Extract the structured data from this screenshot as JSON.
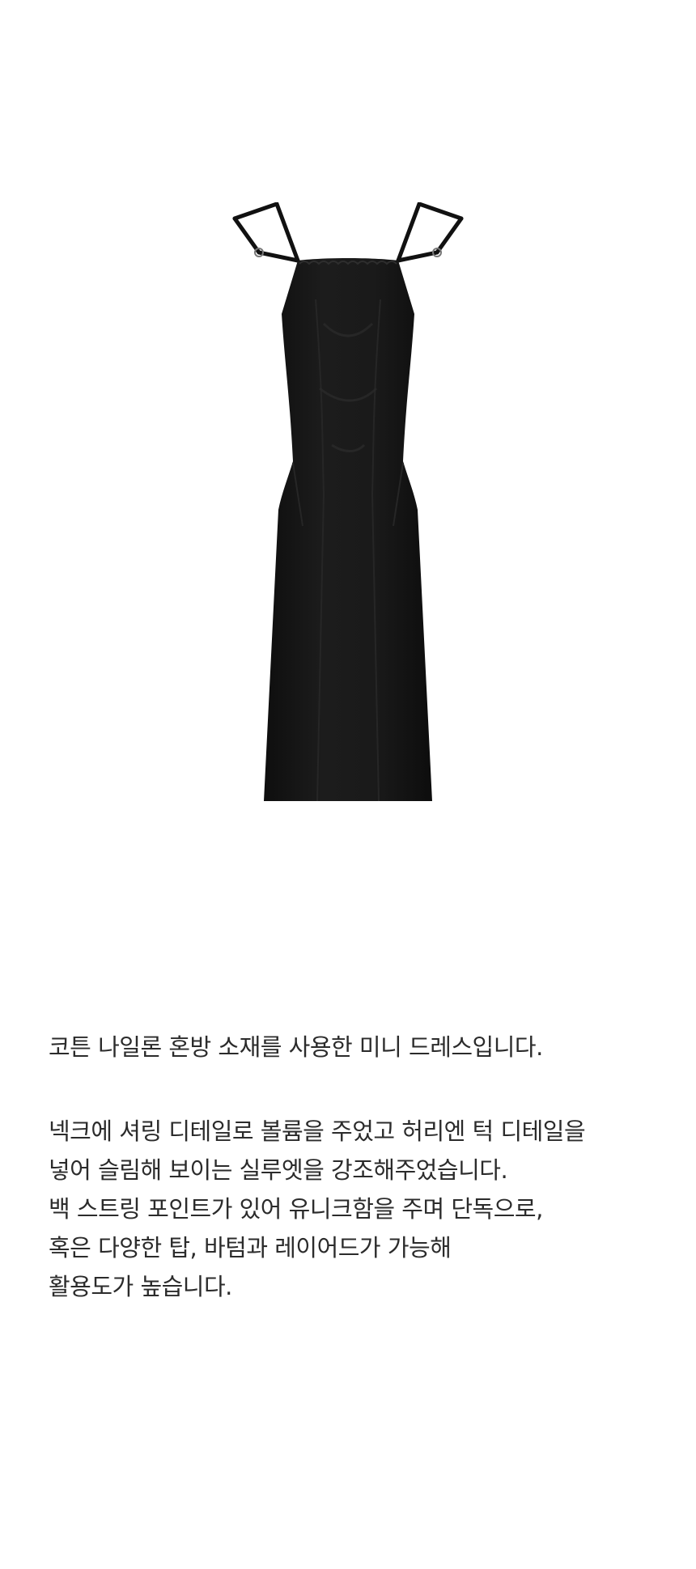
{
  "product": {
    "image": {
      "icon": "black-mini-dress-icon",
      "color": "#161616"
    }
  },
  "description": {
    "intro": "코튼 나일론 혼방 소재를 사용한 미니 드레스입니다.",
    "lines": [
      "넥크에 셔링 디테일로 볼륨을 주었고 허리엔 턱 디테일을",
      "넣어 슬림해 보이는 실루엣을 강조해주었습니다.",
      "백 스트링 포인트가 있어 유니크함을 주며 단독으로,",
      "혹은 다양한 탑, 바텀과 레이어드가 가능해",
      "활용도가 높습니다."
    ]
  }
}
